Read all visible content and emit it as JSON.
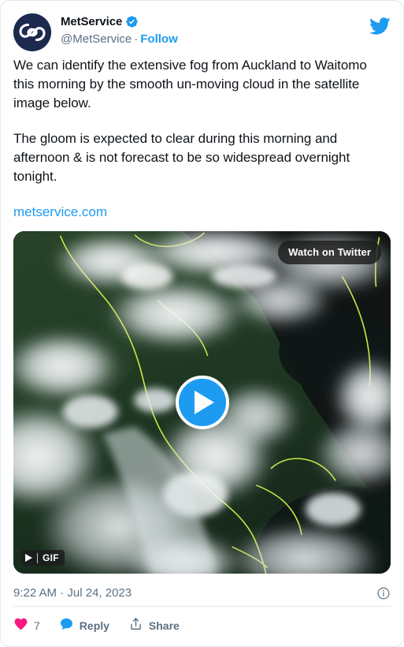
{
  "card": {
    "platform": "Twitter",
    "accent_color": "#1d9bf0",
    "like_color": "#f91880",
    "text_color": "#0f1419",
    "muted_color": "#5b7083",
    "border_color": "#e1e8ed"
  },
  "header": {
    "display_name": "MetService",
    "verified": true,
    "handle": "@MetService",
    "separator": "·",
    "follow_label": "Follow",
    "avatar_bg": "#1b2a4e",
    "bird_icon": "twitter-bird-icon"
  },
  "body": {
    "paragraphs": [
      "We can identify the extensive fog from Auckland to Waitomo this morning by the smooth un-moving cloud in the satellite image below.",
      "The gloom is expected to clear during this morning and afternoon & is not forecast to be so widespread overnight tonight."
    ],
    "link_text": "metservice.com"
  },
  "media": {
    "type": "gif",
    "watch_button_label": "Watch on Twitter",
    "gif_badge_label": "GIF",
    "play_icon": "play-icon",
    "description": "Satellite image of fog over the North Island of New Zealand",
    "land_color": "#14301a",
    "sea_color": "#080d0c",
    "cloud_color": "#f2f5f6",
    "coastline_color": "#d6f23a"
  },
  "meta": {
    "time": "9:22 AM",
    "separator": "·",
    "date": "Jul 24, 2023",
    "info_icon": "info-circle-icon"
  },
  "actions": {
    "like": {
      "icon": "heart-icon",
      "count": "7"
    },
    "reply": {
      "icon": "reply-bubble-icon",
      "label": "Reply"
    },
    "share": {
      "icon": "share-icon",
      "label": "Share"
    }
  }
}
